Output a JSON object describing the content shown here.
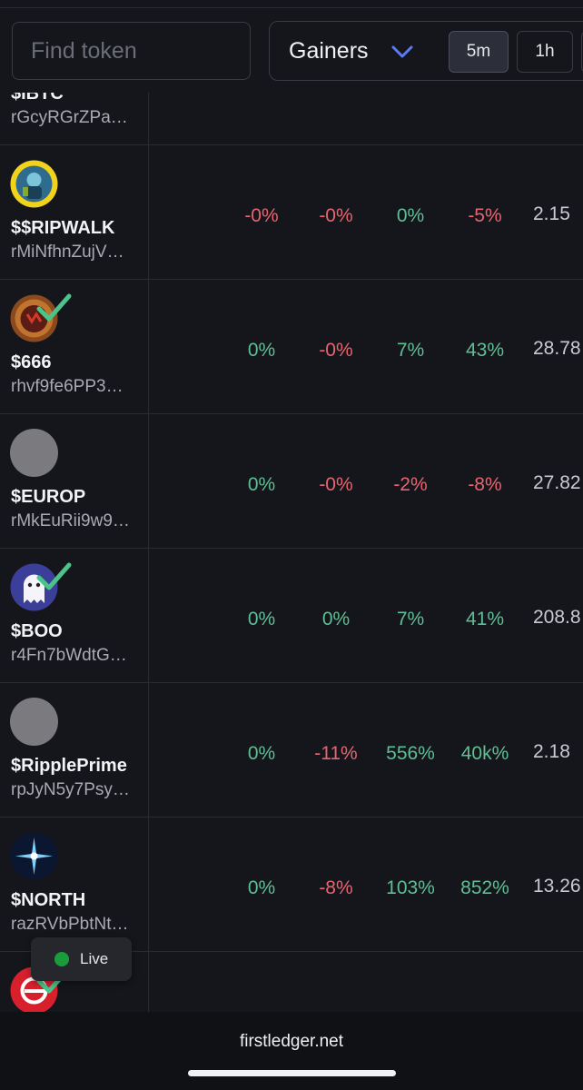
{
  "search": {
    "placeholder": "Find token",
    "value": ""
  },
  "sort": {
    "label": "Gainers",
    "icon": "chevron-down-icon",
    "accent": "#5b7cf5"
  },
  "timeframes": [
    {
      "label": "5m",
      "active": true
    },
    {
      "label": "1h",
      "active": false
    }
  ],
  "rows": [
    {
      "symbol": "$IBTC",
      "address": "rGcyRGrZPa…",
      "changes": [],
      "price": "",
      "avatar": "cut-off-row"
    },
    {
      "symbol": "$$RIPWALK",
      "address": "rMiNfhnZujV…",
      "changes": [
        "-0%",
        "-0%",
        "0%",
        "-5%"
      ],
      "price": "2.15",
      "avatar": "ripwalk-logo-icon"
    },
    {
      "symbol": "$666",
      "address": "rhvf9fe6PP3…",
      "changes": [
        "0%",
        "-0%",
        "7%",
        "43%"
      ],
      "price": "28.78",
      "avatar": "666-logo-icon",
      "verified": true
    },
    {
      "symbol": "$EUROP",
      "address": "rMkEuRii9w9…",
      "changes": [
        "0%",
        "-0%",
        "-2%",
        "-8%"
      ],
      "price": "27.82",
      "avatar": "placeholder-avatar"
    },
    {
      "symbol": "$BOO",
      "address": "r4Fn7bWdtG…",
      "changes": [
        "0%",
        "0%",
        "7%",
        "41%"
      ],
      "price": "208.8",
      "avatar": "ghost-logo-icon",
      "verified": true
    },
    {
      "symbol": "$RipplePrime",
      "address": "rpJyN5y7Psy…",
      "changes": [
        "0%",
        "-11%",
        "556%",
        "40k%"
      ],
      "price": "2.18",
      "avatar": "placeholder-avatar"
    },
    {
      "symbol": "$NORTH",
      "address": "razRVbPbtNt…",
      "changes": [
        "0%",
        "-8%",
        "103%",
        "852%"
      ],
      "price": "13.26",
      "avatar": "north-star-logo-icon"
    }
  ],
  "live_badge": {
    "label": "Live",
    "status_color": "#1a9c3a"
  },
  "browser": {
    "url": "firstledger.net"
  },
  "colors": {
    "positive": "#5fbf94",
    "negative": "#e86470",
    "background": "#15161b"
  }
}
